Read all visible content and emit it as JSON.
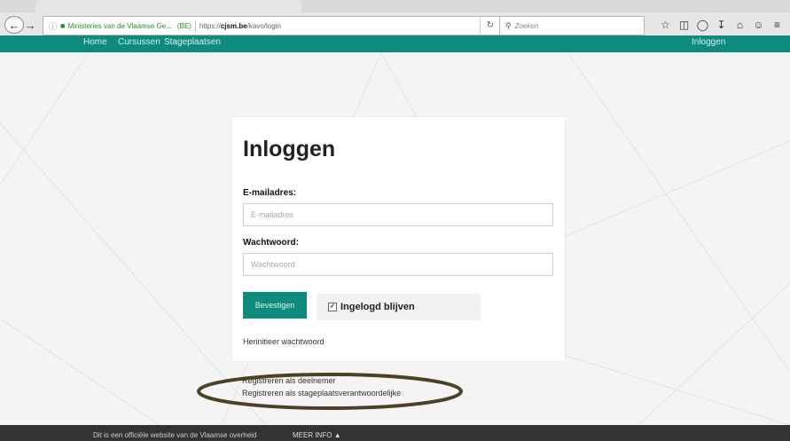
{
  "browser": {
    "org_name": "Ministeries van de Vlaamse Ge...",
    "org_country": "(BE)",
    "url_prefix": "https://",
    "url_domain": "cjsm.be",
    "url_path": "/kavo/login",
    "search_placeholder": "Zoeken"
  },
  "site_nav": {
    "items": [
      "Home",
      "Cursussen",
      "Stageplaatsen"
    ],
    "login": "Inloggen"
  },
  "login_form": {
    "title": "Inloggen",
    "email_label": "E-mailadres:",
    "email_placeholder": "E-mailadres",
    "password_label": "Wachtwoord:",
    "password_placeholder": "Wachtwoord",
    "submit_label": "Bevestigen",
    "remember_label": "Ingelogd blijven",
    "remember_checked": true,
    "reset_link": "Herinitieer wachtwoord"
  },
  "register": {
    "participant": "Registreren als deelnemer",
    "internship_manager": "Registreren als stageplaatsverantwoordelijke"
  },
  "footer": {
    "note": "Dit is een officiële website van de Vlaamse overheid",
    "more_info": "MEER INFO"
  },
  "colors": {
    "brand": "#0e8a7e",
    "annotation": "#4a4226"
  }
}
